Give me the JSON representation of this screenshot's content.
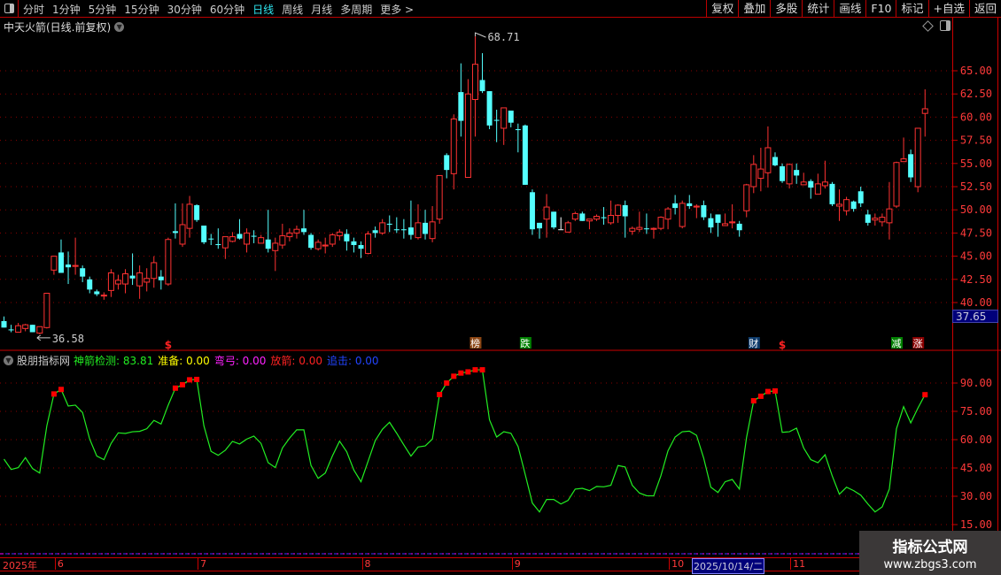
{
  "toolbar": {
    "periods": [
      "分时",
      "1分钟",
      "5分钟",
      "15分钟",
      "30分钟",
      "60分钟",
      "日线",
      "周线",
      "月线",
      "多周期",
      "更多 >"
    ],
    "active_period": "日线",
    "buttons": [
      "复权",
      "叠加",
      "多股",
      "统计",
      "画线",
      "F10",
      "标记",
      "+自选",
      "返回"
    ]
  },
  "chart_title": "中天火箭(日线.前复权)",
  "indicator": {
    "name": "股朋指标网",
    "fields": [
      {
        "label": "神箭检测:",
        "value": "83.81",
        "color": "#22ee22"
      },
      {
        "label": "准备:",
        "value": "0.00",
        "color": "#ffff00"
      },
      {
        "label": "弯弓:",
        "value": "0.00",
        "color": "#ff22ff"
      },
      {
        "label": "放箭:",
        "value": "0.00",
        "color": "#ff2222"
      },
      {
        "label": "追击:",
        "value": "0.00",
        "color": "#2244ff"
      }
    ]
  },
  "price_marker": "37.65",
  "watermark": {
    "line1": "指标公式网",
    "line2": "www.zbgs3.com"
  },
  "date_axis": {
    "year_label": "2025年",
    "months": [
      {
        "label": "6",
        "index": 7
      },
      {
        "label": "7",
        "index": 27
      },
      {
        "label": "8",
        "index": 50
      },
      {
        "label": "9",
        "index": 71
      },
      {
        "label": "10",
        "index": 93
      },
      {
        "label": "11",
        "index": 110
      }
    ],
    "cursor_date": "2025/10/14/二",
    "cursor_index": 96
  },
  "colors": {
    "up": "#ff3232",
    "down": "#54ffff",
    "grid": "#8a0000",
    "axis": "#ff3a3a",
    "line": "#22ee22",
    "signal": "#ff0000"
  },
  "chart_data": [
    {
      "type": "candlestick",
      "y_ticks": [
        "65.00",
        "62.50",
        "60.00",
        "57.50",
        "55.00",
        "52.50",
        "50.00",
        "47.50",
        "45.00",
        "42.50",
        "40.00"
      ],
      "ylim": [
        36.0,
        69.5
      ],
      "annotations": [
        {
          "label": "68.71",
          "index": 66,
          "value": 68.71,
          "kind": "high"
        },
        {
          "label": "36.58",
          "index": 5,
          "value": 36.58,
          "kind": "low"
        }
      ],
      "events": [
        {
          "label": "$",
          "index": 23,
          "color": "#ff2222",
          "box": false
        },
        {
          "label": "榜",
          "index": 66,
          "color": "#8b4513",
          "box": true
        },
        {
          "label": "跌",
          "index": 73,
          "color": "#008000",
          "box": true
        },
        {
          "label": "财",
          "index": 105,
          "color": "#0d3a6a",
          "box": true
        },
        {
          "label": "$",
          "index": 109,
          "color": "#ff2222",
          "box": false
        },
        {
          "label": "减",
          "index": 125,
          "color": "#008000",
          "box": true
        },
        {
          "label": "涨",
          "index": 128,
          "color": "#8b0000",
          "box": true
        }
      ],
      "ohlc": [
        [
          38.0,
          38.5,
          37.3,
          37.3
        ],
        [
          37.1,
          37.6,
          36.8,
          37.0
        ],
        [
          36.8,
          37.8,
          36.8,
          37.5
        ],
        [
          37.2,
          37.7,
          36.9,
          37.6
        ],
        [
          37.6,
          37.6,
          36.8,
          36.8
        ],
        [
          36.7,
          37.4,
          36.58,
          37.4
        ],
        [
          37.3,
          41.0,
          37.2,
          41.0
        ],
        [
          43.5,
          45.0,
          43.0,
          45.0
        ],
        [
          45.4,
          46.8,
          43.2,
          43.2
        ],
        [
          44.1,
          45.5,
          42.0,
          43.8
        ],
        [
          43.9,
          47.0,
          43.0,
          44.0
        ],
        [
          43.7,
          44.0,
          42.2,
          42.8
        ],
        [
          42.5,
          42.8,
          41.0,
          41.4
        ],
        [
          41.2,
          41.4,
          40.7,
          40.9
        ],
        [
          40.7,
          41.1,
          40.3,
          40.8
        ],
        [
          41.3,
          43.6,
          40.6,
          43.2
        ],
        [
          42.0,
          43.0,
          41.4,
          42.4
        ],
        [
          42.0,
          43.6,
          41.0,
          43.1
        ],
        [
          42.9,
          45.3,
          41.9,
          42.6
        ],
        [
          41.8,
          44.0,
          40.4,
          43.2
        ],
        [
          42.2,
          43.7,
          41.2,
          42.6
        ],
        [
          42.6,
          45.0,
          41.6,
          44.3
        ],
        [
          42.8,
          43.5,
          41.4,
          42.4
        ],
        [
          42.0,
          47.0,
          41.8,
          46.8
        ],
        [
          47.7,
          50.7,
          46.9,
          47.5
        ],
        [
          46.3,
          50.7,
          46.0,
          48.4
        ],
        [
          48.0,
          51.5,
          47.0,
          50.6
        ],
        [
          50.5,
          50.6,
          48.7,
          48.9
        ],
        [
          48.3,
          48.3,
          46.3,
          46.5
        ],
        [
          46.9,
          47.4,
          46.2,
          46.8
        ],
        [
          46.3,
          48.0,
          45.8,
          46.2
        ],
        [
          45.9,
          47.1,
          44.7,
          47.1
        ],
        [
          46.6,
          47.6,
          46.5,
          47.1
        ],
        [
          47.4,
          49.0,
          46.8,
          46.9
        ],
        [
          46.3,
          48.0,
          45.4,
          47.5
        ],
        [
          47.2,
          47.8,
          46.4,
          47.1
        ],
        [
          46.4,
          47.3,
          46.4,
          47.0
        ],
        [
          46.8,
          50.0,
          45.4,
          45.8
        ],
        [
          45.6,
          47.0,
          43.4,
          46.4
        ],
        [
          46.2,
          48.5,
          45.8,
          47.2
        ],
        [
          47.1,
          48.0,
          46.6,
          47.5
        ],
        [
          47.5,
          48.3,
          46.9,
          47.9
        ],
        [
          48.0,
          50.0,
          47.3,
          47.6
        ],
        [
          47.3,
          47.5,
          45.7,
          45.9
        ],
        [
          45.8,
          46.8,
          45.6,
          46.5
        ],
        [
          46.1,
          47.0,
          45.3,
          46.2
        ],
        [
          46.3,
          47.5,
          46.0,
          47.3
        ],
        [
          47.2,
          47.9,
          46.7,
          47.6
        ],
        [
          47.4,
          47.9,
          45.6,
          46.6
        ],
        [
          46.6,
          47.0,
          45.4,
          46.2
        ],
        [
          46.2,
          46.6,
          44.8,
          45.8
        ],
        [
          45.3,
          47.7,
          45.2,
          47.4
        ],
        [
          47.8,
          48.2,
          47.0,
          47.5
        ],
        [
          47.5,
          49.0,
          47.3,
          48.6
        ],
        [
          48.5,
          49.4,
          47.6,
          48.4
        ],
        [
          47.9,
          49.2,
          47.5,
          47.8
        ],
        [
          47.9,
          49.0,
          46.9,
          47.8
        ],
        [
          48.1,
          51.0,
          46.8,
          47.3
        ],
        [
          47.0,
          50.6,
          46.8,
          48.6
        ],
        [
          48.6,
          50.0,
          46.8,
          47.4
        ],
        [
          46.9,
          50.4,
          46.5,
          48.7
        ],
        [
          49.0,
          53.7,
          48.5,
          53.7
        ],
        [
          55.9,
          56.1,
          53.4,
          54.3
        ],
        [
          53.9,
          60.3,
          52.2,
          59.8
        ],
        [
          62.7,
          65.8,
          57.9,
          59.6
        ],
        [
          53.5,
          64.1,
          53.5,
          62.5
        ],
        [
          61.9,
          68.71,
          57.9,
          65.7
        ],
        [
          64.0,
          66.9,
          62.6,
          62.8
        ],
        [
          62.8,
          62.8,
          58.7,
          59.1
        ],
        [
          59.7,
          60.8,
          57.3,
          59.6
        ],
        [
          58.8,
          61.0,
          57.0,
          61.0
        ],
        [
          60.7,
          60.7,
          58.9,
          59.4
        ],
        [
          58.7,
          59.3,
          56.2,
          58.6
        ],
        [
          59.1,
          59.2,
          52.7,
          52.7
        ],
        [
          51.9,
          52.2,
          47.3,
          47.9
        ],
        [
          48.6,
          48.6,
          46.9,
          48.0
        ],
        [
          49.0,
          51.7,
          47.0,
          50.3
        ],
        [
          49.8,
          49.8,
          47.9,
          48.1
        ],
        [
          47.9,
          49.2,
          47.9,
          47.9
        ],
        [
          47.6,
          48.8,
          47.6,
          48.6
        ],
        [
          49.0,
          49.8,
          48.8,
          49.6
        ],
        [
          49.6,
          49.8,
          48.8,
          48.8
        ],
        [
          48.8,
          49.0,
          47.9,
          49.0
        ],
        [
          49.0,
          49.5,
          48.8,
          49.3
        ],
        [
          49.2,
          50.3,
          48.4,
          49.1
        ],
        [
          48.6,
          51.0,
          48.4,
          49.4
        ],
        [
          49.4,
          50.6,
          48.6,
          50.5
        ],
        [
          50.5,
          51.0,
          47.0,
          49.3
        ],
        [
          47.7,
          48.2,
          47.3,
          48.0
        ],
        [
          47.9,
          49.8,
          47.6,
          48.1
        ],
        [
          48.0,
          49.6,
          47.4,
          47.9
        ],
        [
          47.9,
          48.1,
          46.9,
          48.0
        ],
        [
          48.0,
          49.3,
          47.8,
          49.2
        ],
        [
          49.0,
          50.3,
          47.9,
          50.1
        ],
        [
          50.7,
          51.6,
          49.5,
          50.2
        ],
        [
          48.2,
          51.0,
          48.0,
          50.7
        ],
        [
          50.7,
          51.6,
          50.1,
          50.4
        ],
        [
          50.3,
          50.6,
          49.1,
          50.4
        ],
        [
          50.5,
          51.0,
          48.9,
          49.2
        ],
        [
          49.1,
          49.6,
          47.5,
          48.1
        ],
        [
          49.5,
          49.5,
          47.1,
          48.6
        ],
        [
          48.3,
          49.6,
          48.3,
          48.5
        ],
        [
          48.6,
          50.6,
          48.0,
          48.7
        ],
        [
          48.5,
          48.8,
          47.1,
          47.8
        ],
        [
          49.9,
          52.8,
          49.2,
          52.7
        ],
        [
          52.5,
          55.9,
          51.8,
          54.9
        ],
        [
          53.4,
          56.7,
          52.0,
          54.4
        ],
        [
          54.0,
          59.0,
          52.4,
          56.7
        ],
        [
          55.7,
          56.2,
          54.7,
          54.8
        ],
        [
          54.7,
          55.0,
          52.9,
          53.1
        ],
        [
          52.8,
          55.0,
          52.3,
          54.9
        ],
        [
          54.3,
          55.0,
          52.8,
          53.7
        ],
        [
          52.7,
          54.0,
          52.7,
          53.0
        ],
        [
          53.1,
          53.3,
          51.2,
          52.4
        ],
        [
          51.7,
          53.9,
          51.7,
          52.8
        ],
        [
          52.6,
          55.3,
          52.3,
          53.0
        ],
        [
          52.8,
          53.0,
          50.4,
          50.6
        ],
        [
          50.4,
          52.2,
          48.8,
          50.6
        ],
        [
          49.9,
          51.4,
          49.4,
          51.1
        ],
        [
          50.9,
          51.0,
          49.8,
          50.1
        ],
        [
          52.0,
          52.5,
          50.3,
          50.7
        ],
        [
          49.5,
          50.0,
          48.3,
          48.6
        ],
        [
          48.9,
          49.6,
          48.3,
          49.1
        ],
        [
          48.7,
          49.6,
          48.2,
          49.2
        ],
        [
          48.6,
          53.0,
          46.8,
          50.1
        ],
        [
          50.4,
          55.2,
          50.2,
          55.1
        ],
        [
          55.2,
          57.8,
          55.2,
          55.5
        ],
        [
          56.0,
          56.5,
          53.0,
          53.5
        ],
        [
          52.5,
          58.8,
          51.9,
          58.8
        ],
        [
          60.4,
          63.0,
          57.9,
          60.9
        ]
      ],
      "doji_white": [
        78
      ]
    },
    {
      "type": "line",
      "series": [
        {
          "name": "神箭检测",
          "values": [
            49.7,
            44.2,
            45.2,
            50.5,
            44.7,
            42.3,
            67.3,
            84.2,
            86.6,
            77.8,
            78.3,
            74.4,
            60.3,
            51.3,
            49.4,
            58.0,
            63.6,
            63.3,
            64.2,
            64.4,
            65.8,
            70.2,
            68.3,
            78.3,
            87.3,
            89.1,
            91.7,
            91.9,
            67.3,
            53.8,
            51.7,
            54.4,
            59.1,
            57.7,
            60.3,
            61.9,
            58.0,
            47.8,
            45.2,
            55.6,
            60.8,
            65.2,
            65.2,
            46.3,
            39.5,
            42.3,
            51.4,
            59.2,
            53.6,
            43.9,
            37.7,
            48.6,
            59.5,
            65.5,
            69.2,
            63.4,
            57.2,
            51.3,
            56.1,
            56.7,
            60.3,
            83.9,
            90.0,
            93.6,
            95.3,
            95.9,
            97.0,
            97.0,
            70.5,
            61.4,
            64.2,
            63.4,
            56.4,
            41.6,
            26.4,
            21.7,
            28.3,
            28.3,
            25.9,
            27.8,
            33.8,
            34.2,
            33.0,
            35.2,
            35.0,
            35.8,
            46.3,
            45.5,
            35.8,
            31.7,
            30.3,
            30.2,
            40.8,
            54.1,
            61.4,
            64.2,
            64.5,
            62.3,
            50.2,
            34.8,
            32.0,
            37.7,
            38.9,
            33.8,
            61.1,
            80.6,
            83.0,
            85.5,
            85.8,
            63.9,
            64.2,
            66.1,
            55.6,
            49.4,
            47.8,
            52.0,
            40.8,
            31.1,
            34.8,
            33.0,
            30.6,
            25.9,
            21.7,
            24.4,
            33.8,
            65.8,
            77.5,
            68.9,
            76.7,
            83.81
          ]
        }
      ],
      "signals": [
        7,
        8,
        24,
        25,
        26,
        27,
        61,
        62,
        63,
        64,
        65,
        66,
        67,
        105,
        106,
        107,
        108,
        129
      ],
      "y_ticks": [
        "90.00",
        "75.00",
        "60.00",
        "45.00",
        "30.00",
        "15.00"
      ],
      "ylim": [
        10,
        100
      ]
    }
  ]
}
